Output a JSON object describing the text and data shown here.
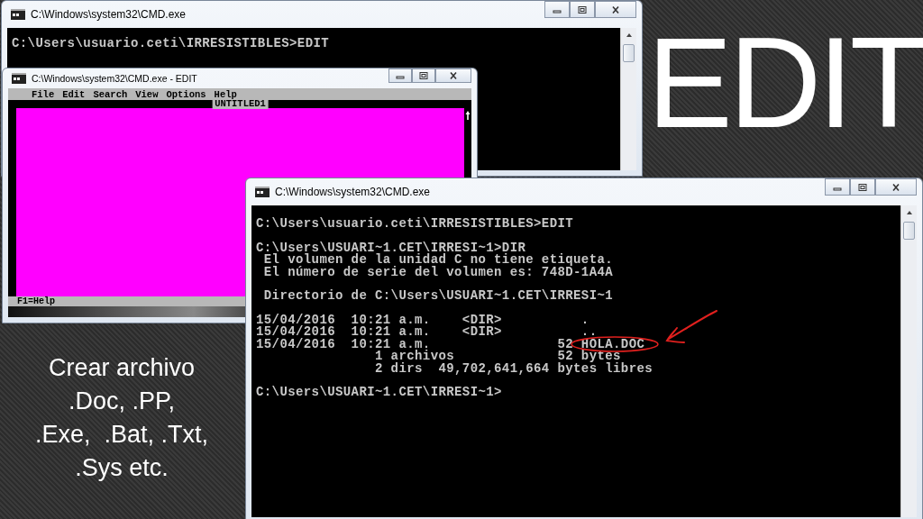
{
  "slide": {
    "title": "EDIT",
    "caption": [
      "Crear archivo",
      ".Doc, .PP,",
      ".Exe,  .Bat, .Txt,",
      ".Sys etc."
    ]
  },
  "windows": [
    {
      "kind": "console",
      "title": "C:\\Windows\\system32\\CMD.exe",
      "blocks": [
        [
          "C:\\Users\\usuario.ceti\\IRRESISTIBLES>EDIT"
        ]
      ]
    },
    {
      "kind": "editor",
      "title": "C:\\Windows\\system32\\CMD.exe - EDIT",
      "menu": [
        "File",
        "Edit",
        "Search",
        "View",
        "Options",
        "Help"
      ],
      "document_title": "UNTITLED1",
      "status": "F1=Help"
    },
    {
      "kind": "console",
      "title": "C:\\Windows\\system32\\CMD.exe",
      "blocks": [
        [
          "C:\\Users\\usuario.ceti\\IRRESISTIBLES>EDIT"
        ],
        [
          "C:\\Users\\USUARI~1.CET\\IRRESI~1>DIR",
          " El volumen de la unidad C no tiene etiqueta.",
          " El número de serie del volumen es: 748D-1A4A"
        ],
        [
          " Directorio de C:\\Users\\USUARI~1.CET\\IRRESI~1"
        ],
        [
          "15/04/2016  10:21 a.m.    <DIR>          .",
          "15/04/2016  10:21 a.m.    <DIR>          ..",
          "15/04/2016  10:21 a.m.                52 HOLA.DOC",
          "               1 archivos             52 bytes",
          "               2 dirs  49,702,641,664 bytes libres"
        ],
        [
          "C:\\Users\\USUARI~1.CET\\IRRESI~1>"
        ]
      ]
    }
  ]
}
